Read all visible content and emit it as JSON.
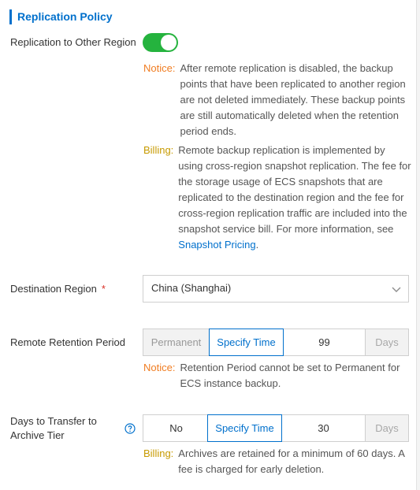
{
  "section": {
    "title": "Replication Policy"
  },
  "replication": {
    "label": "Replication to Other Region",
    "enabled": true,
    "notice_tag": "Notice:",
    "notice_text": "After remote replication is disabled, the backup points that have been replicated to another region are not deleted immediately. These backup points are still automatically deleted when the retention period ends.",
    "billing_tag": "Billing:",
    "billing_text": "Remote backup replication is implemented by using cross-region snapshot replication. The fee for the storage usage of ECS snapshots that are replicated to the destination region and the fee for cross-region replication traffic are included into the snapshot service bill. For more information, see",
    "billing_link": "Snapshot Pricing",
    "billing_end": "."
  },
  "destination": {
    "label": "Destination Region",
    "required_mark": "*",
    "value": "China (Shanghai)"
  },
  "retention": {
    "label": "Remote Retention Period",
    "options": [
      "Permanent",
      "Specify Time"
    ],
    "selected": "Specify Time",
    "value": "99",
    "unit": "Days",
    "notice_tag": "Notice:",
    "notice_text": "Retention Period cannot be set to Permanent for ECS instance backup."
  },
  "archive": {
    "label": "Days to Transfer to Archive Tier",
    "options": [
      "No",
      "Specify Time"
    ],
    "selected": "Specify Time",
    "value": "30",
    "unit": "Days",
    "billing_tag": "Billing:",
    "billing_text": "Archives are retained for a minimum of 60 days. A fee is charged for early deletion."
  },
  "colors": {
    "accent": "#0070cc",
    "toggle_on": "#25b33e",
    "notice": "#f07d22",
    "billing": "#c79a00",
    "required": "#d93026"
  },
  "icons": [
    "chevron-down-icon",
    "help-circle-icon"
  ]
}
